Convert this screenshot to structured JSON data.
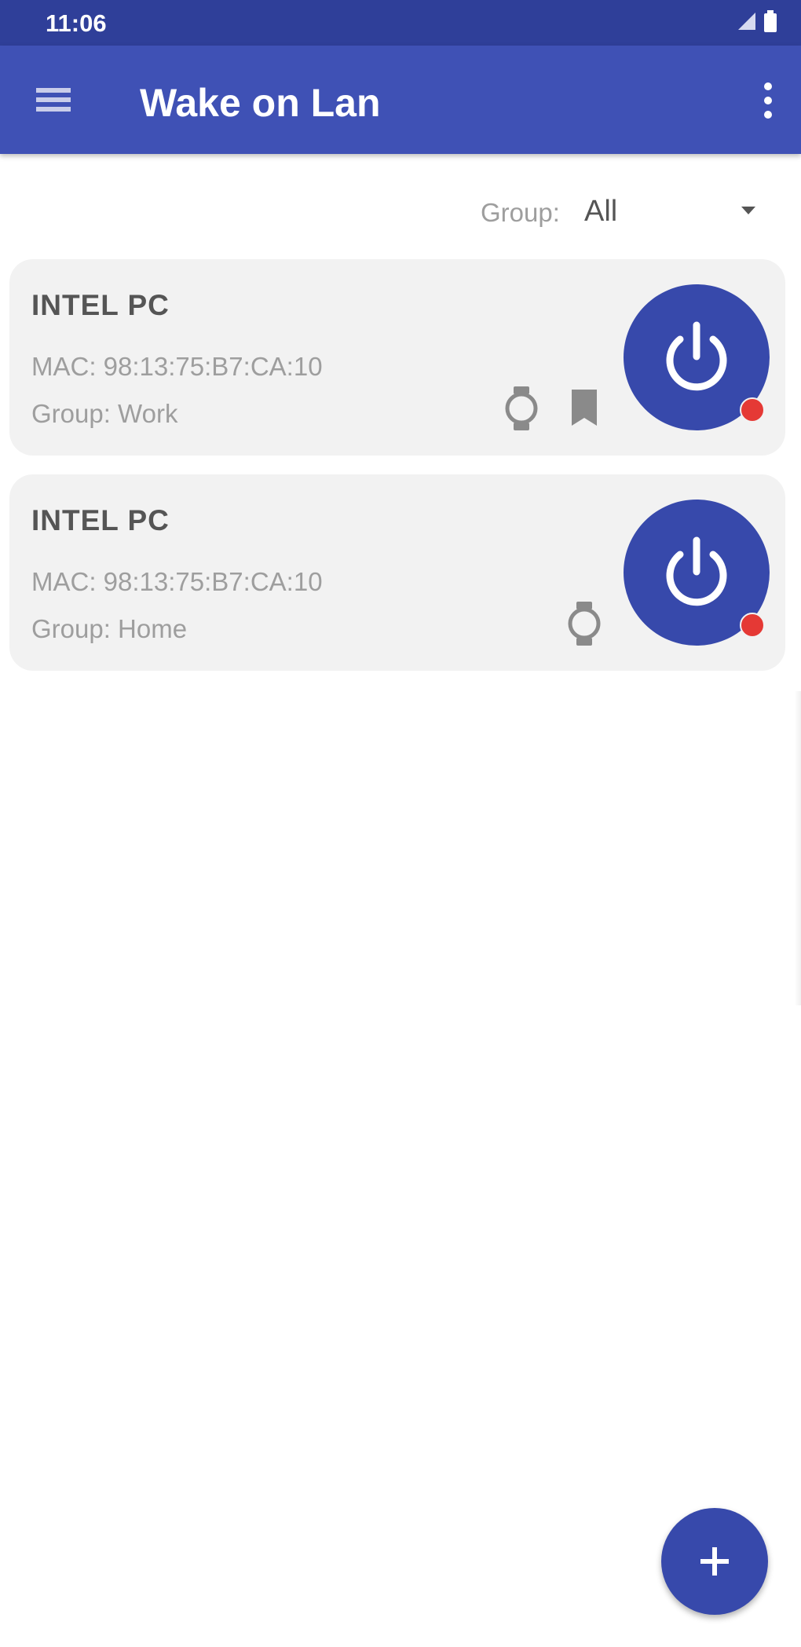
{
  "status_bar": {
    "time": "11:06",
    "icons": [
      "signal-icon",
      "battery-icon"
    ]
  },
  "app_bar": {
    "title": "Wake on Lan",
    "menu_icon": "hamburger-menu-icon",
    "overflow_icon": "more-vert-icon",
    "color": "#3f51b5"
  },
  "group_filter": {
    "label": "Group:",
    "selected": "All"
  },
  "devices": [
    {
      "name": "INTEL PC",
      "mac": "MAC: 98:13:75:B7:CA:10",
      "group": "Group: Work",
      "icons": [
        "watch-icon",
        "bookmark-icon"
      ],
      "status_color": "#e53935"
    },
    {
      "name": "INTEL PC",
      "mac": "MAC: 98:13:75:B7:CA:10",
      "group": "Group: Home",
      "icons": [
        "watch-icon"
      ],
      "status_color": "#e53935"
    }
  ],
  "fab": {
    "icon": "plus-icon",
    "color": "#3749ab"
  }
}
